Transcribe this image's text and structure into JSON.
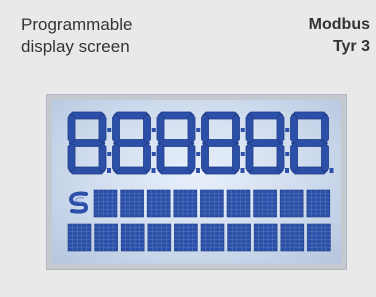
{
  "title": {
    "line1": "Programmable",
    "line2": "display screen"
  },
  "model": {
    "line1": "Modbus",
    "line2": "Tyr 3"
  },
  "display": {
    "digits_count": 6,
    "digit_text": "888888",
    "matrix_rows": 2,
    "matrix_cols_row1": 9,
    "matrix_cols_row2": 10,
    "icon": "s-logo-icon",
    "colors": {
      "segment": "#2c50a8",
      "segment_edge": "#1e3c88",
      "background": "#d6e2f2",
      "frame": "#c4c8cf"
    }
  }
}
